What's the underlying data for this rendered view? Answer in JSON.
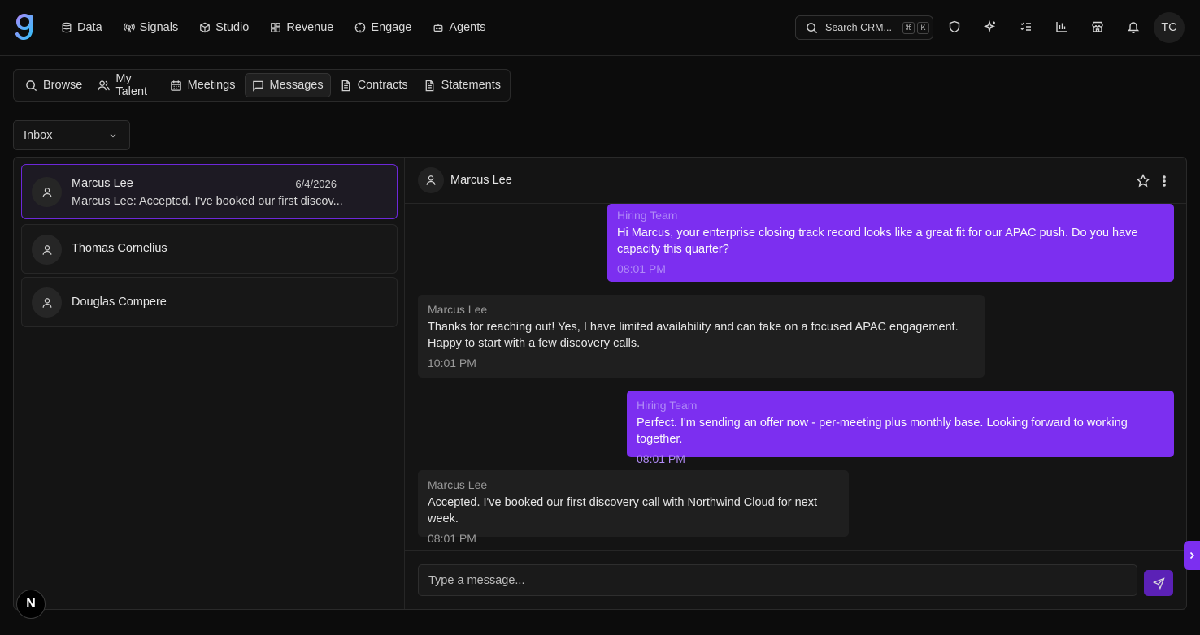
{
  "nav": {
    "items": [
      {
        "label": "Data",
        "icon": "database-icon"
      },
      {
        "label": "Signals",
        "icon": "broadcast-icon"
      },
      {
        "label": "Studio",
        "icon": "cube-icon"
      },
      {
        "label": "Revenue",
        "icon": "grid-icon"
      },
      {
        "label": "Engage",
        "icon": "target-icon"
      },
      {
        "label": "Agents",
        "icon": "bot-icon"
      }
    ],
    "search_placeholder": "Search CRM...",
    "search_kbd_1": "⌘",
    "search_kbd_2": "K",
    "user_initials": "TC"
  },
  "tabs": [
    {
      "label": "Browse"
    },
    {
      "label": "My Talent"
    },
    {
      "label": "Meetings"
    },
    {
      "label": "Messages"
    },
    {
      "label": "Contracts"
    },
    {
      "label": "Statements"
    }
  ],
  "active_tab": "Messages",
  "inbox_filter": "Inbox",
  "conversations": [
    {
      "name": "Marcus Lee",
      "date": "6/4/2026",
      "preview": "Marcus Lee: Accepted. I've booked our first discov..."
    },
    {
      "name": "Thomas Cornelius"
    },
    {
      "name": "Douglas Compere"
    }
  ],
  "chat": {
    "contact": "Marcus Lee",
    "messages": [
      {
        "sender": "Hiring Team",
        "text": "Hi Marcus, your enterprise closing track record looks like a great fit for our APAC push. Do you have capacity this quarter?",
        "time": "08:01 PM",
        "direction": "out"
      },
      {
        "sender": "Marcus Lee",
        "text": "Thanks for reaching out! Yes, I have limited availability and can take on a focused APAC engagement. Happy to start with a few discovery calls.",
        "time": "10:01 PM",
        "direction": "in"
      },
      {
        "sender": "Hiring Team",
        "text": "Perfect. I'm sending an offer now - per-meeting plus monthly base. Looking forward to working together.",
        "time": "08:01 PM",
        "direction": "out"
      },
      {
        "sender": "Marcus Lee",
        "text": "Accepted. I've booked our first discovery call with Northwind Cloud for next week.",
        "time": "08:01 PM",
        "direction": "in"
      }
    ],
    "composer_placeholder": "Type a message..."
  },
  "colors": {
    "accent": "#7c2ff0",
    "background": "#0c0c0c",
    "panel": "#141414"
  },
  "dev_badge": "N"
}
